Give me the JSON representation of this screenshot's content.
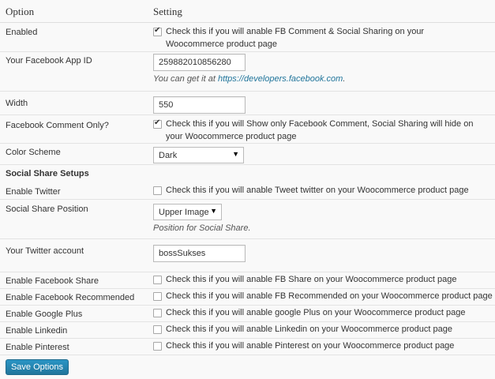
{
  "header": {
    "option": "Option",
    "setting": "Setting"
  },
  "rows": {
    "enabled": {
      "label": "Enabled",
      "checked": true,
      "text": "Check this if you will anable FB Comment & Social Sharing on your Woocommerce product page"
    },
    "app_id": {
      "label": "Your Facebook App ID",
      "value": "259882010856280",
      "help_prefix": "You can get it at ",
      "help_link": "https://developers.facebook.com",
      "help_suffix": "."
    },
    "width": {
      "label": "Width",
      "value": "550"
    },
    "comment_only": {
      "label": "Facebook Comment Only?",
      "checked": true,
      "text": "Check this if you will Show only Facebook Comment, Social Sharing will hide on your Woocommerce product page"
    },
    "color_scheme": {
      "label": "Color Scheme",
      "selected": "Dark"
    },
    "social_section": {
      "label": "Social Share Setups"
    },
    "twitter": {
      "label": "Enable Twitter",
      "checked": false,
      "text": "Check this if you will anable Tweet twitter on your Woocommerce product page"
    },
    "position": {
      "label": "Social Share Position",
      "selected": "Upper Image",
      "help": "Position for Social Share."
    },
    "twitter_account": {
      "label": "Your Twitter account",
      "value": "bossSukses"
    },
    "fb_share": {
      "label": "Enable Facebook Share",
      "checked": false,
      "text": "Check this if you will anable FB Share on your Woocommerce product page"
    },
    "fb_recommended": {
      "label": "Enable Facebook Recommended",
      "checked": false,
      "text": "Check this if you will anable FB Recommended on your Woocommerce product page"
    },
    "google_plus": {
      "label": "Enable Google Plus",
      "checked": false,
      "text": "Check this if you will anable google Plus on your Woocommerce product page"
    },
    "linkedin": {
      "label": "Enable Linkedin",
      "checked": false,
      "text": "Check this if you will anable Linkedin on your Woocommerce product page"
    },
    "pinterest": {
      "label": "Enable Pinterest",
      "checked": false,
      "text": "Check this if you will anable Pinterest on your Woocommerce product page"
    }
  },
  "save_button": "Save Options",
  "colors": {
    "accent": "#21759b",
    "border": "#e3e3e3"
  }
}
